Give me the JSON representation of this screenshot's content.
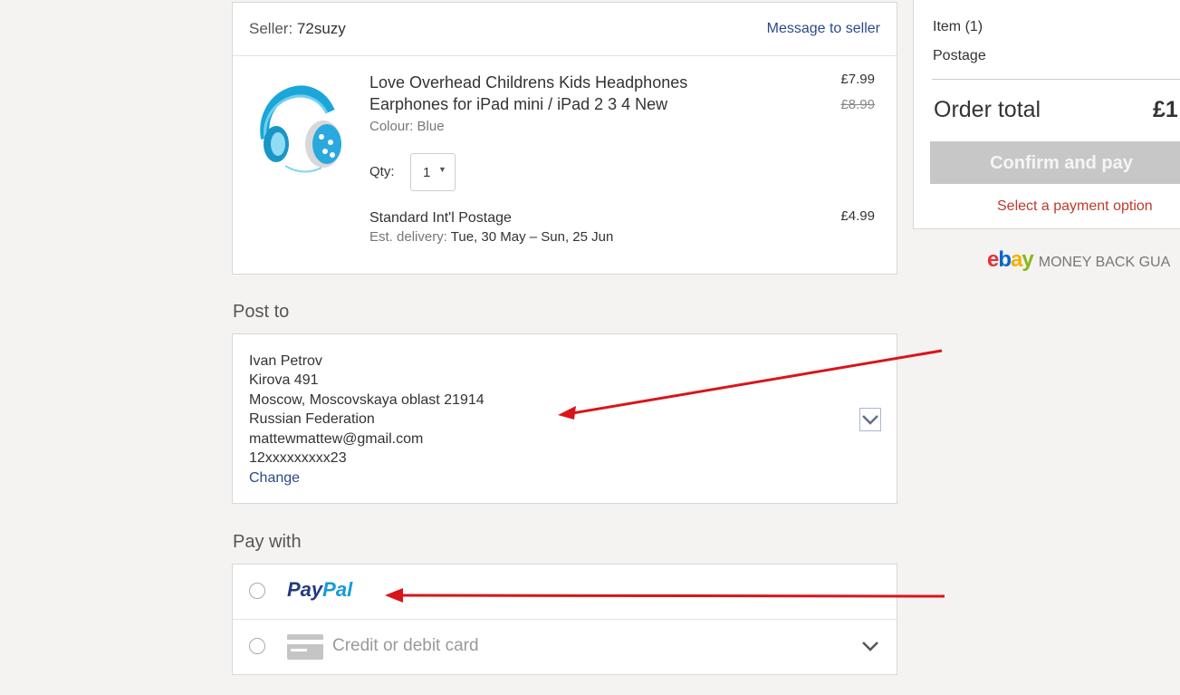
{
  "seller": {
    "label": "Seller: ",
    "name": "72suzy",
    "message_link": "Message to seller"
  },
  "item": {
    "title": "Love Overhead Childrens Kids Headphones Earphones for iPad mini / iPad 2 3 4 New",
    "colour": "Colour: Blue",
    "price": "£7.99",
    "original_price": "£8.99",
    "qty_label": "Qty:",
    "qty_value": "1",
    "postage_name": "Standard Int'l Postage",
    "postage_price": "£4.99",
    "delivery_prefix": "Est. delivery: ",
    "delivery_range": "Tue, 30 May – Sun, 25 Jun"
  },
  "post_to": {
    "heading": "Post to",
    "name": "Ivan Petrov",
    "street": "Kirova 491",
    "city_line": "Moscow, Moscovskaya oblast 21914",
    "country": "Russian Federation",
    "email": "mattewmattew@gmail.com",
    "phone": "12xxxxxxxxx23",
    "change_link": "Change"
  },
  "pay_with": {
    "heading": "Pay with",
    "paypal_part1": "Pay",
    "paypal_part2": "Pal",
    "card_label": "Credit or debit card"
  },
  "summary": {
    "item_label": "Item (",
    "item_count": "1",
    "item_label_end": ")",
    "postage_label": "Postage",
    "order_total_label": "Order total",
    "order_total_value": "£1",
    "confirm_button": "Confirm and pay",
    "hint": "Select a payment option"
  },
  "guarantee": {
    "logo_e": "e",
    "logo_b": "b",
    "logo_a": "a",
    "logo_y": "y",
    "text": "MONEY BACK GUA"
  },
  "colors": {
    "link": "#2b4a8b",
    "hint": "#c0392b",
    "annotation_arrow": "#d9141b",
    "paypal_dark": "#253b80",
    "paypal_light": "#179bd7"
  }
}
